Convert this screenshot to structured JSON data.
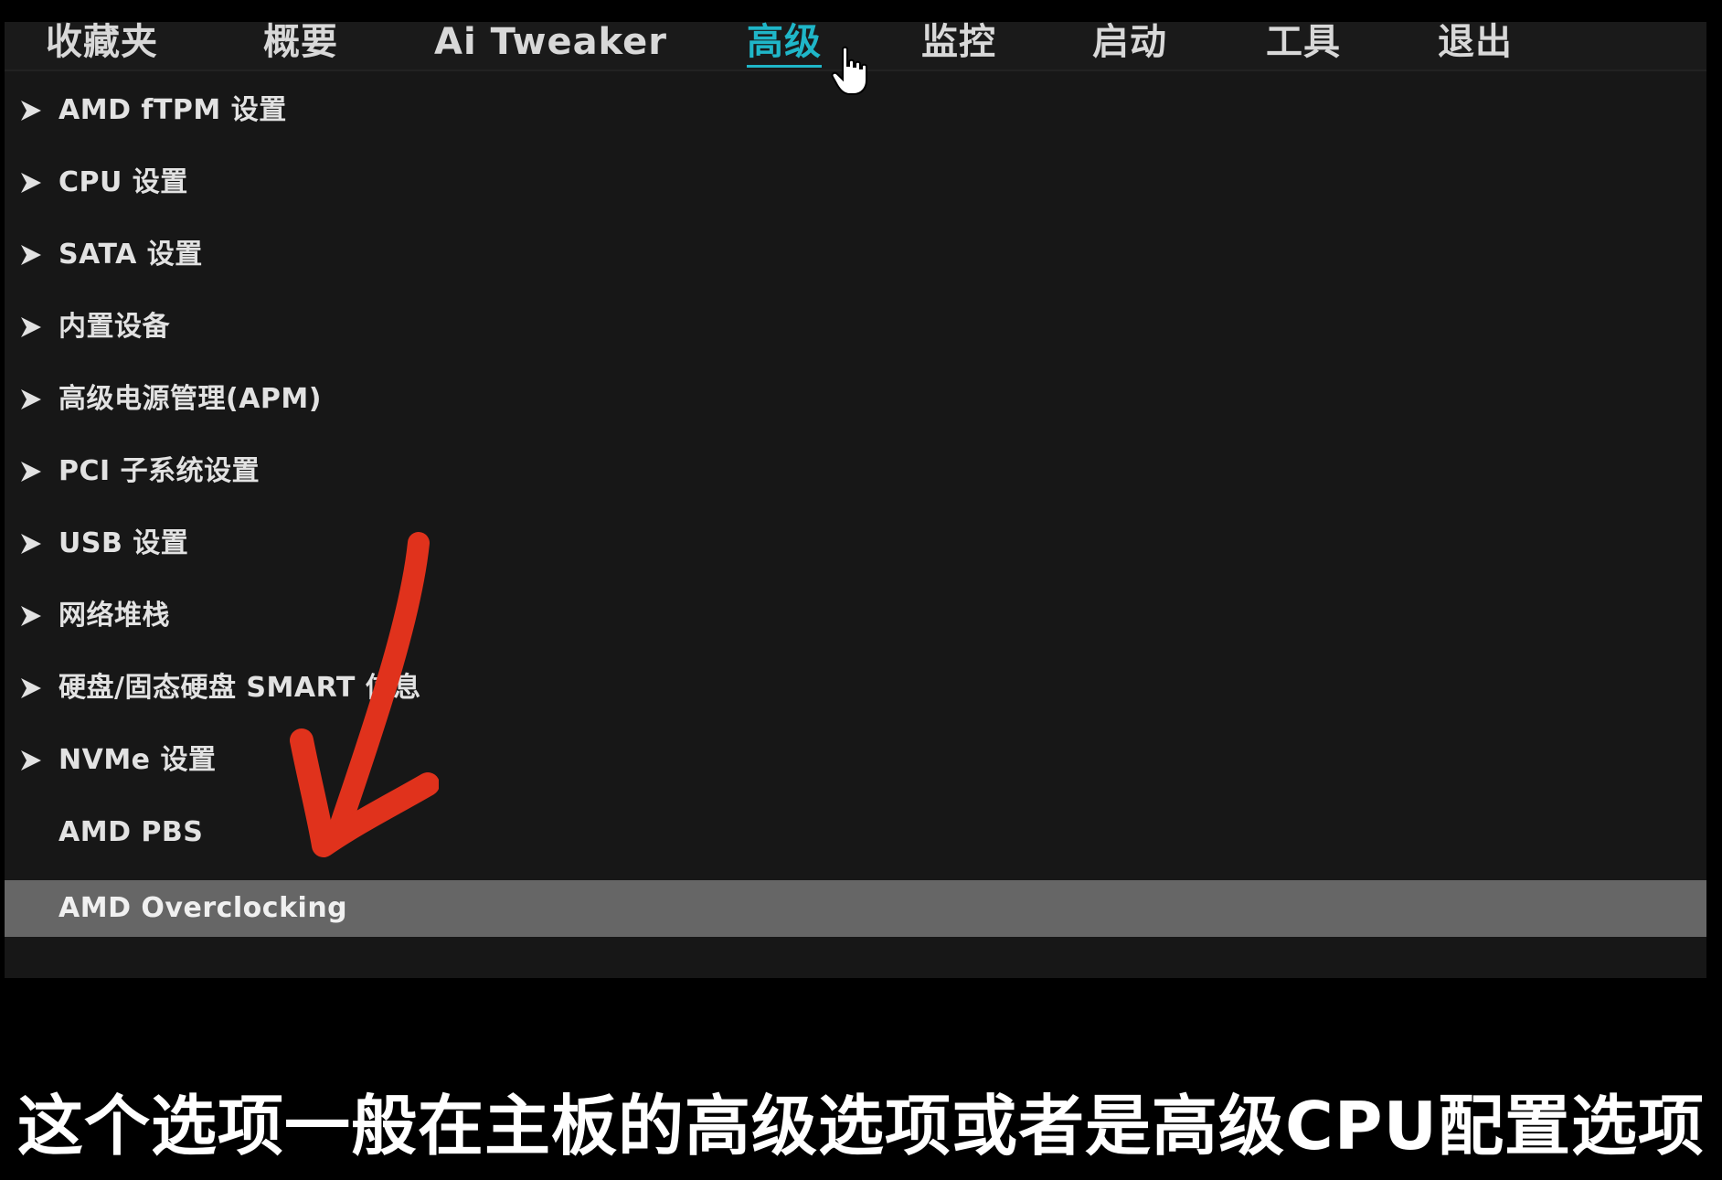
{
  "tabs": [
    {
      "label": "收藏夹",
      "active": false
    },
    {
      "label": "概要",
      "active": false
    },
    {
      "label": "Ai Tweaker",
      "active": false
    },
    {
      "label": "高级",
      "active": true
    },
    {
      "label": "监控",
      "active": false
    },
    {
      "label": "启动",
      "active": false
    },
    {
      "label": "工具",
      "active": false
    },
    {
      "label": "退出",
      "active": false
    }
  ],
  "menu": {
    "items": [
      {
        "label": "AMD fTPM 设置",
        "has_submenu": true
      },
      {
        "label": "CPU 设置",
        "has_submenu": true
      },
      {
        "label": "SATA 设置",
        "has_submenu": true
      },
      {
        "label": "内置设备",
        "has_submenu": true
      },
      {
        "label": "高级电源管理(APM)",
        "has_submenu": true
      },
      {
        "label": "PCI 子系统设置",
        "has_submenu": true
      },
      {
        "label": "USB 设置",
        "has_submenu": true
      },
      {
        "label": "网络堆栈",
        "has_submenu": true
      },
      {
        "label": "硬盘/固态硬盘 SMART 信息",
        "has_submenu": true
      },
      {
        "label": "NVMe 设置",
        "has_submenu": true
      },
      {
        "label": "AMD PBS",
        "has_submenu": false
      },
      {
        "label": "AMD Overclocking",
        "has_submenu": false,
        "selected": true
      }
    ]
  },
  "caption": "这个选项一般在主板的高级选项或者是高级CPU配置选项",
  "colors": {
    "background": "#000000",
    "panel": "#171717",
    "active_tab": "#1fb6c8",
    "selected_row": "#666666",
    "annotation_arrow": "#e0321c"
  },
  "icons": {
    "submenu": "chevron-right-icon",
    "pointer": "hand-pointer-icon",
    "annotation": "hand-drawn-arrow"
  }
}
